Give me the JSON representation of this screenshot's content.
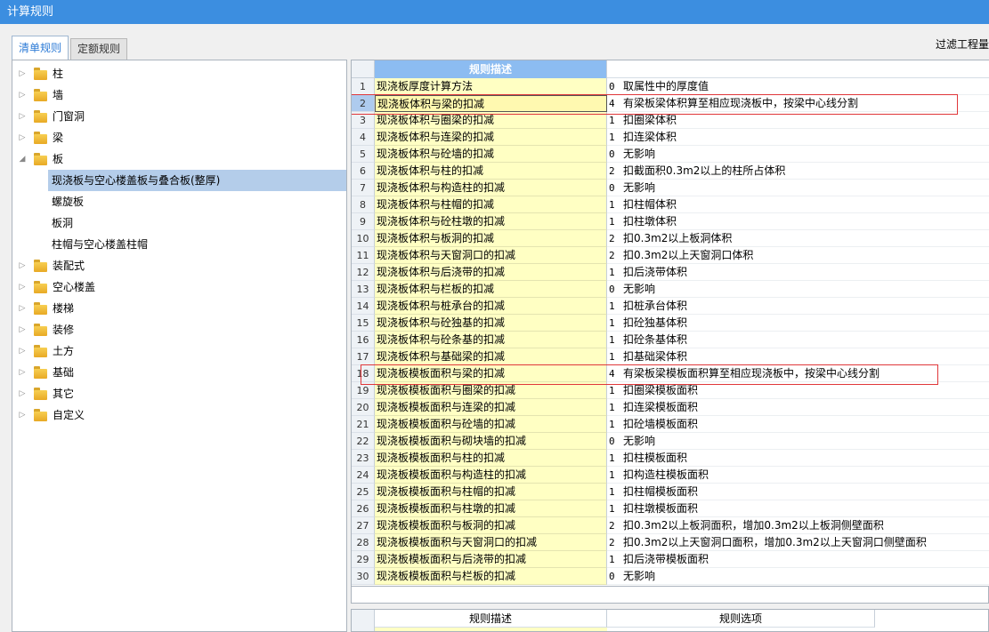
{
  "window": {
    "title": "计算规则"
  },
  "tabs": [
    {
      "label": "清单规则",
      "active": true
    },
    {
      "label": "定额规则",
      "active": false
    }
  ],
  "filter_label": "过滤工程量",
  "tree": [
    {
      "label": "柱",
      "expanded": false
    },
    {
      "label": "墙",
      "expanded": false
    },
    {
      "label": "门窗洞",
      "expanded": false
    },
    {
      "label": "梁",
      "expanded": false
    },
    {
      "label": "板",
      "expanded": true,
      "children": [
        {
          "label": "现浇板与空心楼盖板与叠合板(整厚)",
          "selected": true
        },
        {
          "label": "螺旋板"
        },
        {
          "label": "板洞"
        },
        {
          "label": "柱帽与空心楼盖柱帽"
        }
      ]
    },
    {
      "label": "装配式",
      "expanded": false
    },
    {
      "label": "空心楼盖",
      "expanded": false
    },
    {
      "label": "楼梯",
      "expanded": false
    },
    {
      "label": "装修",
      "expanded": false
    },
    {
      "label": "土方",
      "expanded": false
    },
    {
      "label": "基础",
      "expanded": false
    },
    {
      "label": "其它",
      "expanded": false
    },
    {
      "label": "自定义",
      "expanded": false
    }
  ],
  "grid": {
    "header_desc": "规则描述",
    "selected_row": 2,
    "highlighted_rows": [
      2,
      18
    ],
    "rows": [
      {
        "n": "1",
        "desc": "现浇板厚度计算方法",
        "code": "0",
        "text": "取属性中的厚度值"
      },
      {
        "n": "2",
        "desc": "现浇板体积与梁的扣减",
        "code": "4",
        "text": "有梁板梁体积算至相应现浇板中，按梁中心线分割"
      },
      {
        "n": "3",
        "desc": "现浇板体积与圈梁的扣减",
        "code": "1",
        "text": "扣圈梁体积"
      },
      {
        "n": "4",
        "desc": "现浇板体积与连梁的扣减",
        "code": "1",
        "text": "扣连梁体积"
      },
      {
        "n": "5",
        "desc": "现浇板体积与砼墙的扣减",
        "code": "0",
        "text": "无影响"
      },
      {
        "n": "6",
        "desc": "现浇板体积与柱的扣减",
        "code": "2",
        "text": "扣截面积0.3m2以上的柱所占体积"
      },
      {
        "n": "7",
        "desc": "现浇板体积与构造柱的扣减",
        "code": "0",
        "text": "无影响"
      },
      {
        "n": "8",
        "desc": "现浇板体积与柱帽的扣减",
        "code": "1",
        "text": "扣柱帽体积"
      },
      {
        "n": "9",
        "desc": "现浇板体积与砼柱墩的扣减",
        "code": "1",
        "text": "扣柱墩体积"
      },
      {
        "n": "10",
        "desc": "现浇板体积与板洞的扣减",
        "code": "2",
        "text": "扣0.3m2以上板洞体积"
      },
      {
        "n": "11",
        "desc": "现浇板体积与天窗洞口的扣减",
        "code": "2",
        "text": "扣0.3m2以上天窗洞口体积"
      },
      {
        "n": "12",
        "desc": "现浇板体积与后浇带的扣减",
        "code": "1",
        "text": "扣后浇带体积"
      },
      {
        "n": "13",
        "desc": "现浇板体积与栏板的扣减",
        "code": "0",
        "text": "无影响"
      },
      {
        "n": "14",
        "desc": "现浇板体积与桩承台的扣减",
        "code": "1",
        "text": "扣桩承台体积"
      },
      {
        "n": "15",
        "desc": "现浇板体积与砼独基的扣减",
        "code": "1",
        "text": "扣砼独基体积"
      },
      {
        "n": "16",
        "desc": "现浇板体积与砼条基的扣减",
        "code": "1",
        "text": "扣砼条基体积"
      },
      {
        "n": "17",
        "desc": "现浇板体积与基础梁的扣减",
        "code": "1",
        "text": "扣基础梁体积"
      },
      {
        "n": "18",
        "desc": "现浇板模板面积与梁的扣减",
        "code": "4",
        "text": "有梁板梁模板面积算至相应现浇板中，按梁中心线分割"
      },
      {
        "n": "19",
        "desc": "现浇板模板面积与圈梁的扣减",
        "code": "1",
        "text": "扣圈梁模板面积"
      },
      {
        "n": "20",
        "desc": "现浇板模板面积与连梁的扣减",
        "code": "1",
        "text": "扣连梁模板面积"
      },
      {
        "n": "21",
        "desc": "现浇板模板面积与砼墙的扣减",
        "code": "1",
        "text": "扣砼墙模板面积"
      },
      {
        "n": "22",
        "desc": "现浇板模板面积与砌块墙的扣减",
        "code": "0",
        "text": "无影响"
      },
      {
        "n": "23",
        "desc": "现浇板模板面积与柱的扣减",
        "code": "1",
        "text": "扣柱模板面积"
      },
      {
        "n": "24",
        "desc": "现浇板模板面积与构造柱的扣减",
        "code": "1",
        "text": "扣构造柱模板面积"
      },
      {
        "n": "25",
        "desc": "现浇板模板面积与柱帽的扣减",
        "code": "1",
        "text": "扣柱帽模板面积"
      },
      {
        "n": "26",
        "desc": "现浇板模板面积与柱墩的扣减",
        "code": "1",
        "text": "扣柱墩模板面积"
      },
      {
        "n": "27",
        "desc": "现浇板模板面积与板洞的扣减",
        "code": "2",
        "text": "扣0.3m2以上板洞面积，增加0.3m2以上板洞侧壁面积"
      },
      {
        "n": "28",
        "desc": "现浇板模板面积与天窗洞口的扣减",
        "code": "2",
        "text": "扣0.3m2以上天窗洞口面积，增加0.3m2以上天窗洞口侧壁面积"
      },
      {
        "n": "29",
        "desc": "现浇板模板面积与后浇带的扣减",
        "code": "1",
        "text": "扣后浇带模板面积"
      },
      {
        "n": "30",
        "desc": "现浇板模板面积与栏板的扣减",
        "code": "0",
        "text": "无影响"
      }
    ]
  },
  "bottom": {
    "col_desc": "规则描述",
    "col_option": "规则选项"
  }
}
